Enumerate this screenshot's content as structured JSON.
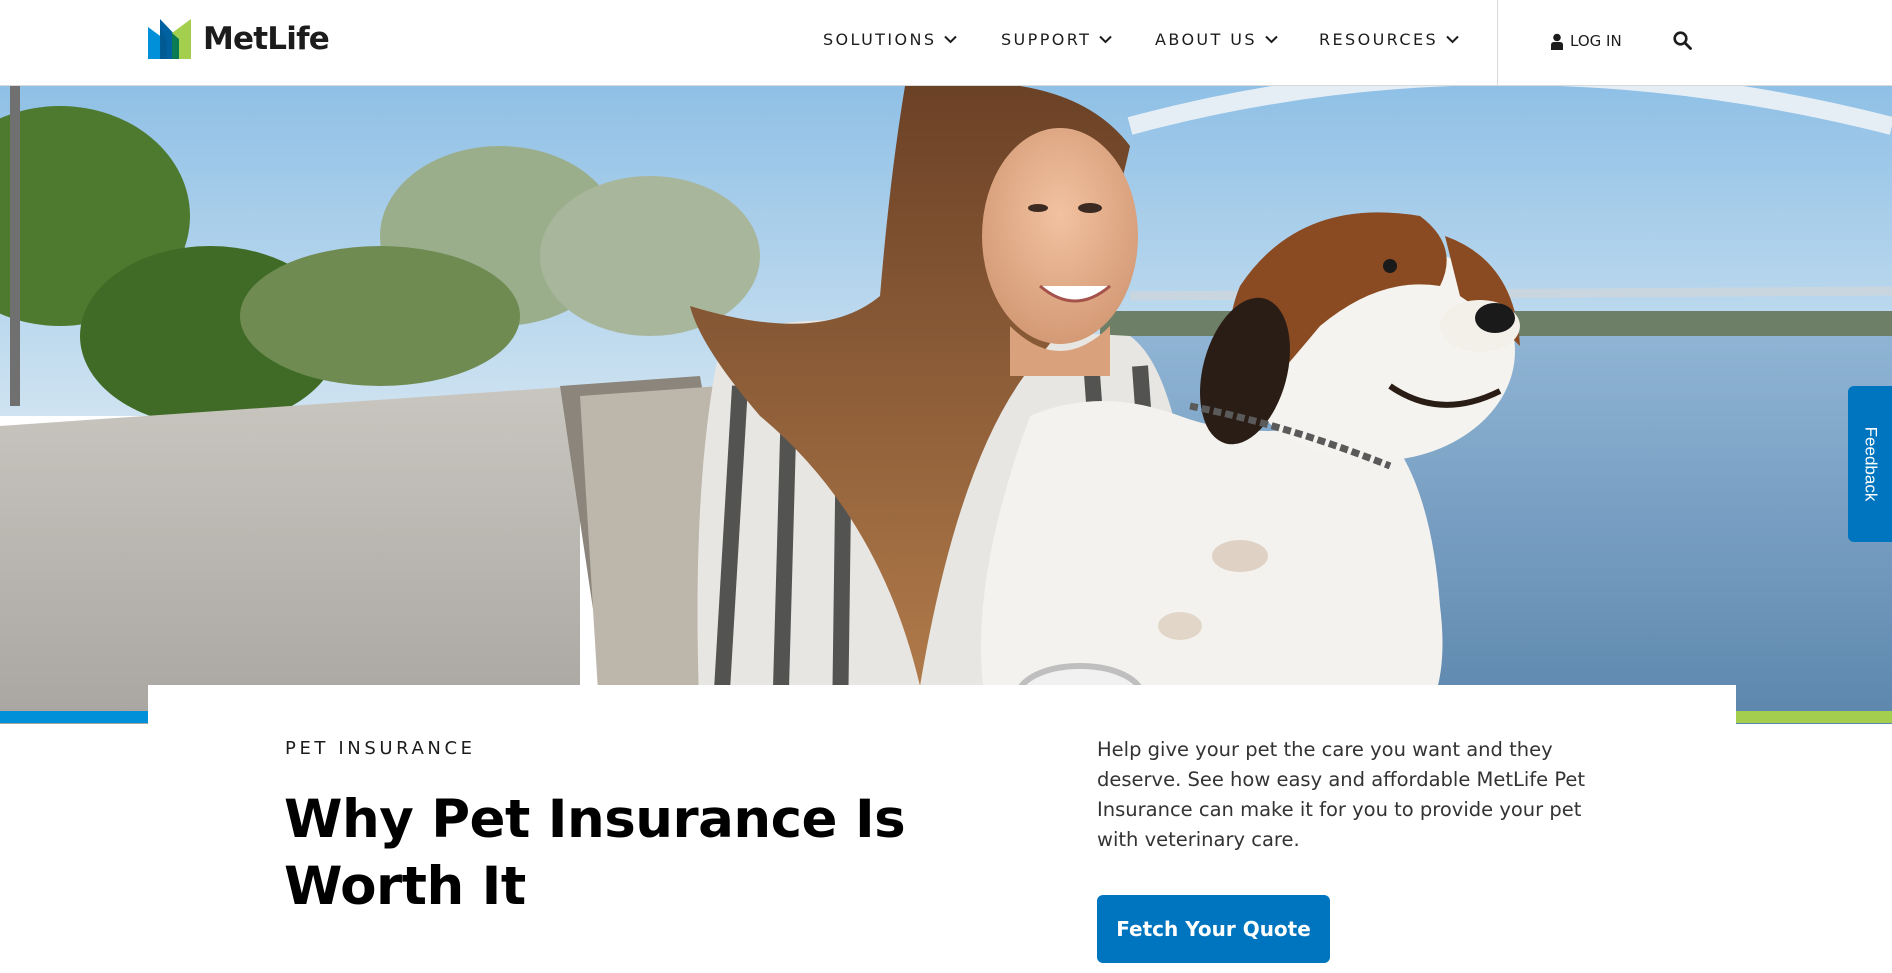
{
  "brand": {
    "name": "MetLife",
    "colors": {
      "blue": "#0090da",
      "dark_blue": "#0061a0",
      "green": "#a4ce4e",
      "button": "#0075bf"
    }
  },
  "header": {
    "nav": [
      {
        "label": "SOLUTIONS",
        "icon": "chevron-down-icon"
      },
      {
        "label": "SUPPORT",
        "icon": "chevron-down-icon"
      },
      {
        "label": "ABOUT US",
        "icon": "chevron-down-icon"
      },
      {
        "label": "RESOURCES",
        "icon": "chevron-down-icon"
      }
    ],
    "login_label": "LOG IN",
    "login_icon": "user-icon",
    "search_icon": "search-icon"
  },
  "hero": {
    "image_icon": "hero-photo"
  },
  "content": {
    "eyebrow": "PET INSURANCE",
    "headline": "Why Pet Insurance Is Worth It",
    "description": "Help give your pet the care you want and they deserve. See how easy and affordable MetLife Pet Insurance can make it for you to provide your pet with veterinary care.",
    "cta_label": "Fetch Your Quote"
  },
  "feedback_label": "Feedback"
}
